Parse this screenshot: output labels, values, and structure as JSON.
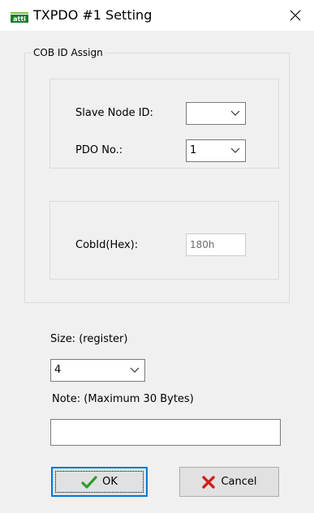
{
  "window": {
    "title": "TXPDO #1 Setting",
    "app_icon_text": "atti"
  },
  "cob_group": {
    "label": "COB ID Assign",
    "slave_node_label": "Slave Node ID:",
    "slave_node_value": "",
    "pdo_label": "PDO No.:",
    "pdo_value": "1",
    "cobid_label": "CobId(Hex):",
    "cobid_value": "180h"
  },
  "size": {
    "label": "Size: (register)",
    "value": "4"
  },
  "note": {
    "label": "Note: (Maximum 30 Bytes)",
    "value": ""
  },
  "buttons": {
    "ok_label": "OK",
    "cancel_label": "Cancel"
  },
  "colors": {
    "ok_check": "#2e9c2e",
    "cancel_x": "#d0201a",
    "focus_border": "#0078d7",
    "app_icon": "#1f7a30"
  }
}
